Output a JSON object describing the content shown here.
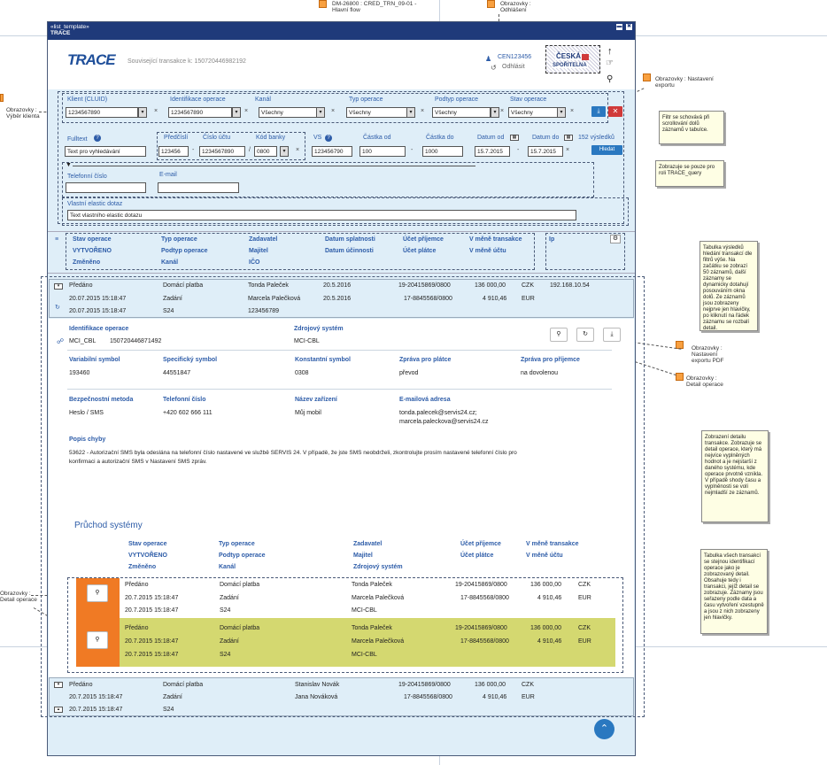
{
  "annotations": {
    "top_center": [
      "DM-26800 : CRED_TRN_09-01 -",
      "Hlavní flow"
    ],
    "top_right": [
      "Obrazovky :",
      "Odhlášení"
    ],
    "left_top": [
      "Obrazovky :",
      "Výběr klienta"
    ],
    "right_export": [
      "Obrazovky : Nastavení",
      "exportu"
    ],
    "right_pdf": [
      "Obrazovky :",
      "Nastavení",
      "exportu PDF"
    ],
    "right_detail": [
      "Obrazovky :",
      "Detail operace"
    ],
    "left_bottom": [
      "Obrazovky :",
      "Detail operace"
    ]
  },
  "notes": {
    "filter": "Filtr se schovává při scrollování dolů záznamů v tabulce.",
    "query": "Zobrazuje se pouze pro roli TRACE_query",
    "results": "Tabulka výsledků hledání transakcí dle filtrů výše. Na začátku se zobrazí 50 záznamů, další záznamy se dynamicky dotahují posouváním okna dolů. Ze záznamů jsou zobrazeny nejprve jen hlavičky, po kliknutí na řádek záznamu se rozbalí detail.",
    "detail": "Zobrazení detailu transakce. Zobrazuje se detail operace, který má nejvíce vyplněných hodnot a je nejstarší z daného systému, kde operace prvotně vznikla. V případě shody času a vyplněnosti se volí nejmladší ze záznamů.",
    "systems": "Tabulka všech transakcí se stejnou identifikací operace jako je zobrazovaný detail. Obsahuje tedy i transakci, jejíž detail se zobrazuje. Záznamy jsou seřazeny podle data a času vytvoření vzestupně a jsou z nich zobrazeny jen hlavičky."
  },
  "window": {
    "subtitle": "«list_template»",
    "title": "TRACE",
    "min_btn": "▬",
    "close_btn": "✖"
  },
  "header": {
    "logo": "TRACE",
    "related": "Související transakce k: 150720446982192",
    "user": "CEN123456",
    "logout": "Odhlásit",
    "bank_logo_1": "ČESKÁ",
    "bank_logo_2": "SPOŘITELNA"
  },
  "filter": {
    "client_label": "Klient (CLUID)",
    "client_value": "1234567890",
    "opid_label": "Identifikace operace",
    "opid_value": "1234567890",
    "channel_label": "Kanál",
    "channel_value": "Všechny",
    "type_label": "Typ operace",
    "type_value": "Všechny",
    "subtype_label": "Podtyp operace",
    "subtype_value": "Všechny",
    "state_label": "Stav operace",
    "state_value": "Všechny",
    "fulltext_label": "Fulltext",
    "fulltext_value": "Text pro vyhledávání",
    "prefix_label": "Předčíslí",
    "prefix_value": "123456",
    "account_label": "Číslo účtu",
    "account_value": "1234567890",
    "bank_label": "Kód banky",
    "bank_value": "0800",
    "vs_label": "VS",
    "vs_value": "123456790",
    "amount_from_label": "Částka od",
    "amount_from_value": "100",
    "amount_to_label": "Částka do",
    "amount_to_value": "1000",
    "date_from_label": "Datum od",
    "date_from_value": "15.7.2015",
    "date_to_label": "Datum do",
    "date_to_value": "15.7.2015",
    "count": "152 výsledků",
    "search_btn": "Hledat",
    "phone_label": "Telefonní číslo",
    "email_label": "E-mail",
    "elastic_label": "Vlastní elastic dotaz",
    "elastic_value": "Text vlastního elastic dotazu"
  },
  "columns": {
    "c1": [
      "Stav operace",
      "VYTVOŘENO",
      "Změněno"
    ],
    "c2": [
      "Typ operace",
      "Podtyp operace",
      "Kanál"
    ],
    "c3": [
      "Zadavatel",
      "Majitel",
      "IČO"
    ],
    "c4": [
      "Datum splatnosti",
      "Datum účinnosti"
    ],
    "c5": [
      "Účet příjemce",
      "Účet plátce"
    ],
    "c6": [
      "V měně transakce",
      "V měně účtu"
    ],
    "c7": [
      "Ip"
    ]
  },
  "row1": {
    "a": [
      "Předáno",
      "20.07.2015 15:18:47",
      "20.07.2015 15:18:47"
    ],
    "b": [
      "Domácí platba",
      "Zadání",
      "S24"
    ],
    "c": [
      "Tonda Paleček",
      "Marcela Palečková",
      "123456789"
    ],
    "d": [
      "20.5.2016",
      "20.5.2016"
    ],
    "e": [
      "19-20415869/0800",
      "17-8845568/0800"
    ],
    "f": [
      "136 000,00",
      "4 910,46"
    ],
    "g": [
      "CZK",
      "EUR"
    ],
    "ip": "192.168.10.54"
  },
  "detail": {
    "opid_label": "Identifikace operace",
    "opid_a": "MCI_CBL",
    "opid_b": "150720446871492",
    "src_label": "Zdrojový systém",
    "src_value": "MCI-CBL",
    "vs_label": "Variabilní symbol",
    "vs_value": "193460",
    "ss_label": "Specifický symbol",
    "ss_value": "44551847",
    "ks_label": "Konstantní symbol",
    "ks_value": "0308",
    "msg_payer_label": "Zpráva pro plátce",
    "msg_payer_value": "převod",
    "msg_rcv_label": "Zpráva pro příjemce",
    "msg_rcv_value": "na dovolenou",
    "sec_label": "Bezpečnostní metoda",
    "sec_value": "Heslo / SMS",
    "phone_label": "Telefonní číslo",
    "phone_value": "+420 602 666 111",
    "device_label": "Název zařízení",
    "device_value": "Můj mobil",
    "email_label": "E-mailová adresa",
    "email_1": "tonda.palecek@servis24.cz;",
    "email_2": "marcela.paleckova@servis24.cz",
    "err_label": "Popis chyby",
    "err_1": "53622 - Autorizační SMS byla odeslána na telefonní číslo nastavené ve službě SERVIS 24. V případě, že jste SMS neobdrželi, zkontrolujte prosím nastavené telefonní číslo pro",
    "err_2": "konfirmaci a autorizační SMS v Nastavení SMS zpráv."
  },
  "systems": {
    "title": "Průchod systémy",
    "h1": [
      "Stav operace",
      "VYTVOŘENO",
      "Změněno"
    ],
    "h2": [
      "Typ operace",
      "Podtyp operace",
      "Kanál"
    ],
    "h3": [
      "Zadavatel",
      "Majitel",
      "Zdrojový systém"
    ],
    "h4": [
      "Účet příjemce",
      "Účet plátce"
    ],
    "h5": [
      "V měně transakce",
      "V měně účtu"
    ],
    "r1": {
      "a": [
        "Předáno",
        "20.7.2015 15:18:47",
        "20.7.2015 15:18:47"
      ],
      "b": [
        "Domácí platba",
        "Zadání",
        "S24"
      ],
      "c": [
        "Tonda Paleček",
        "Marcela Palečková",
        "MCI-CBL"
      ],
      "d": [
        "19-20415869/0800",
        "17-8845568/0800"
      ],
      "e": [
        "136 000,00",
        "4 910,46"
      ],
      "f": [
        "CZK",
        "EUR"
      ]
    },
    "r2": {
      "a": [
        "Předáno",
        "20.7.2015 15:18:47",
        "20.7.2015 15:18:47"
      ],
      "b": [
        "Domácí platba",
        "Zadání",
        "S24"
      ],
      "c": [
        "Tonda Paleček",
        "Marcela Palečková",
        "MCI-CBL"
      ],
      "d": [
        "19-20415869/0800",
        "17-8845568/0800"
      ],
      "e": [
        "136 000,00",
        "4 910,46"
      ],
      "f": [
        "CZK",
        "EUR"
      ]
    }
  },
  "row2": {
    "a": [
      "Předáno",
      "20.7.2015 15:18:47",
      "20.7.2015 15:18:47"
    ],
    "b": [
      "Domácí platba",
      "Zadání",
      "S24"
    ],
    "c": [
      "Stanislav Novák",
      "Jana Nováková"
    ],
    "e": [
      "19-20415869/0800",
      "17-8845568/0800"
    ],
    "f": [
      "136 000,00",
      "4 910,46"
    ],
    "g": [
      "CZK",
      "EUR"
    ]
  },
  "colors": {
    "accent": "#2d5ca8",
    "orange": "#f07a24",
    "olive": "#d4d870",
    "title_bar": "#1f3a7a"
  }
}
